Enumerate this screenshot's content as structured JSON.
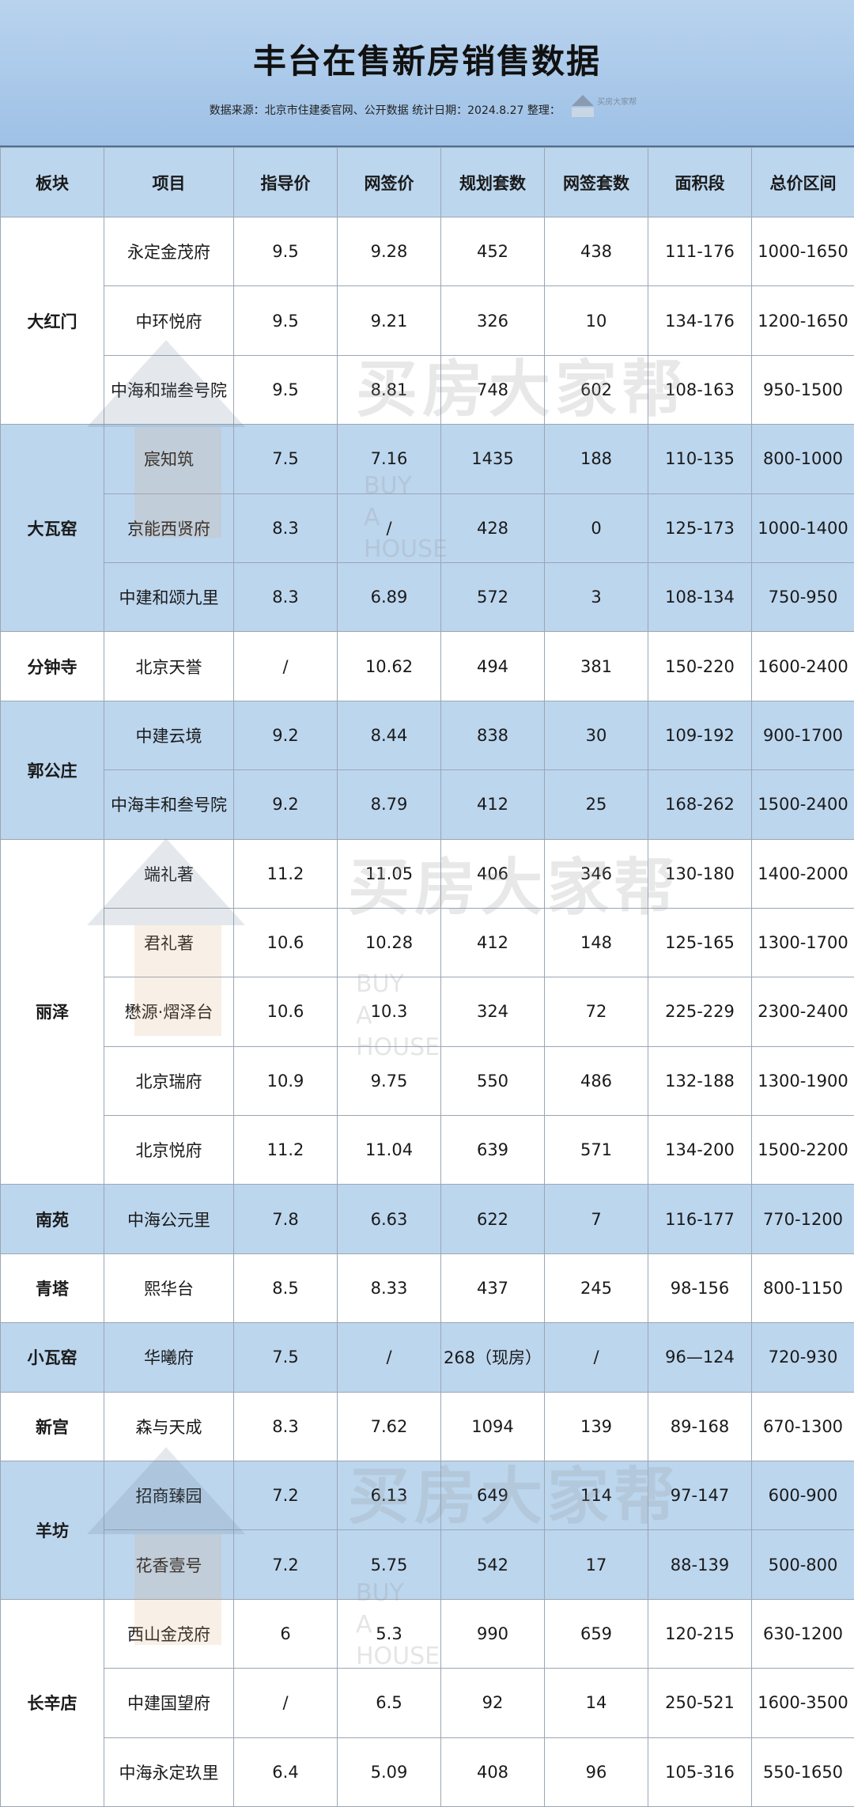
{
  "header": {
    "title": "丰台在售新房销售数据",
    "subtitle": "数据来源：北京市住建委官网、公开数据 统计日期：2024.8.27 整理：",
    "logo_text": "买房大家帮"
  },
  "columns": [
    "板块",
    "项目",
    "指导价",
    "网签价",
    "规划套数",
    "网签套数",
    "面积段",
    "总价区间"
  ],
  "groups": [
    {
      "block": "大红门",
      "rows": [
        {
          "project": "永定金茂府",
          "guide": "9.5",
          "sign": "9.28",
          "planned": "452",
          "signed": "438",
          "area": "111-176",
          "total": "1000-1650"
        },
        {
          "project": "中环悦府",
          "guide": "9.5",
          "sign": "9.21",
          "planned": "326",
          "signed": "10",
          "area": "134-176",
          "total": "1200-1650"
        },
        {
          "project": "中海和瑞叁号院",
          "guide": "9.5",
          "sign": "8.81",
          "planned": "748",
          "signed": "602",
          "area": "108-163",
          "total": "950-1500"
        }
      ]
    },
    {
      "block": "大瓦窑",
      "rows": [
        {
          "project": "宸知筑",
          "guide": "7.5",
          "sign": "7.16",
          "planned": "1435",
          "signed": "188",
          "area": "110-135",
          "total": "800-1000"
        },
        {
          "project": "京能西贤府",
          "guide": "8.3",
          "sign": "/",
          "planned": "428",
          "signed": "0",
          "area": "125-173",
          "total": "1000-1400"
        },
        {
          "project": "中建和颂九里",
          "guide": "8.3",
          "sign": "6.89",
          "planned": "572",
          "signed": "3",
          "area": "108-134",
          "total": "750-950"
        }
      ]
    },
    {
      "block": "分钟寺",
      "rows": [
        {
          "project": "北京天誉",
          "guide": "/",
          "sign": "10.62",
          "planned": "494",
          "signed": "381",
          "area": "150-220",
          "total": "1600-2400"
        }
      ]
    },
    {
      "block": "郭公庄",
      "rows": [
        {
          "project": "中建云境",
          "guide": "9.2",
          "sign": "8.44",
          "planned": "838",
          "signed": "30",
          "area": "109-192",
          "total": "900-1700"
        },
        {
          "project": "中海丰和叁号院",
          "guide": "9.2",
          "sign": "8.79",
          "planned": "412",
          "signed": "25",
          "area": "168-262",
          "total": "1500-2400"
        }
      ]
    },
    {
      "block": "丽泽",
      "rows": [
        {
          "project": "端礼著",
          "guide": "11.2",
          "sign": "11.05",
          "planned": "406",
          "signed": "346",
          "area": "130-180",
          "total": "1400-2000"
        },
        {
          "project": "君礼著",
          "guide": "10.6",
          "sign": "10.28",
          "planned": "412",
          "signed": "148",
          "area": "125-165",
          "total": "1300-1700"
        },
        {
          "project": "懋源·熠泽台",
          "guide": "10.6",
          "sign": "10.3",
          "planned": "324",
          "signed": "72",
          "area": "225-229",
          "total": "2300-2400"
        },
        {
          "project": "北京瑞府",
          "guide": "10.9",
          "sign": "9.75",
          "planned": "550",
          "signed": "486",
          "area": "132-188",
          "total": "1300-1900"
        },
        {
          "project": "北京悦府",
          "guide": "11.2",
          "sign": "11.04",
          "planned": "639",
          "signed": "571",
          "area": "134-200",
          "total": "1500-2200"
        }
      ]
    },
    {
      "block": "南苑",
      "rows": [
        {
          "project": "中海公元里",
          "guide": "7.8",
          "sign": "6.63",
          "planned": "622",
          "signed": "7",
          "area": "116-177",
          "total": "770-1200"
        }
      ]
    },
    {
      "block": "青塔",
      "rows": [
        {
          "project": "熙华台",
          "guide": "8.5",
          "sign": "8.33",
          "planned": "437",
          "signed": "245",
          "area": "98-156",
          "total": "800-1150"
        }
      ]
    },
    {
      "block": "小瓦窑",
      "rows": [
        {
          "project": "华曦府",
          "guide": "7.5",
          "sign": "/",
          "planned": "268（现房）",
          "signed": "/",
          "area": "96—124",
          "total": "720-930"
        }
      ]
    },
    {
      "block": "新宫",
      "rows": [
        {
          "project": "森与天成",
          "guide": "8.3",
          "sign": "7.62",
          "planned": "1094",
          "signed": "139",
          "area": "89-168",
          "total": "670-1300"
        }
      ]
    },
    {
      "block": "羊坊",
      "rows": [
        {
          "project": "招商臻园",
          "guide": "7.2",
          "sign": "6.13",
          "planned": "649",
          "signed": "114",
          "area": "97-147",
          "total": "600-900"
        },
        {
          "project": "花香壹号",
          "guide": "7.2",
          "sign": "5.75",
          "planned": "542",
          "signed": "17",
          "area": "88-139",
          "total": "500-800"
        }
      ]
    },
    {
      "block": "长辛店",
      "rows": [
        {
          "project": "西山金茂府",
          "guide": "6",
          "sign": "5.3",
          "planned": "990",
          "signed": "659",
          "area": "120-215",
          "total": "630-1200"
        },
        {
          "project": "中建国望府",
          "guide": "/",
          "sign": "6.5",
          "planned": "92",
          "signed": "14",
          "area": "250-521",
          "total": "1600-3500"
        },
        {
          "project": "中海永定玖里",
          "guide": "6.4",
          "sign": "5.09",
          "planned": "408",
          "signed": "96",
          "area": "105-316",
          "total": "550-1650"
        }
      ]
    }
  ],
  "watermark": {
    "cn": "买房大家帮",
    "en": [
      "BUY",
      "A",
      "HOUSE"
    ]
  },
  "colors": {
    "header_bg": "#9ec1e6",
    "band_blue": "#bcd6ee",
    "band_white": "#ffffff",
    "border": "#9aa6b3"
  }
}
